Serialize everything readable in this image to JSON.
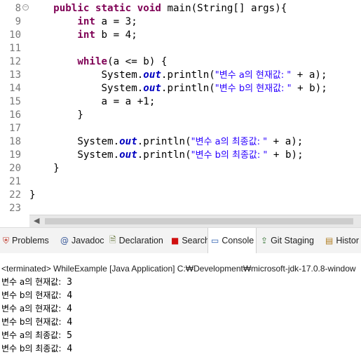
{
  "editor": {
    "lines": [
      {
        "n": "8",
        "seg": [
          {
            "t": "    "
          },
          {
            "t": "public static void",
            "c": "kw"
          },
          {
            "t": " main(String[] args){"
          }
        ]
      },
      {
        "n": "9",
        "seg": [
          {
            "t": "        "
          },
          {
            "t": "int",
            "c": "kw"
          },
          {
            "t": " a = 3;"
          }
        ]
      },
      {
        "n": "10",
        "seg": [
          {
            "t": "        "
          },
          {
            "t": "int",
            "c": "kw"
          },
          {
            "t": " b = 4;"
          }
        ]
      },
      {
        "n": "11",
        "seg": []
      },
      {
        "n": "12",
        "seg": [
          {
            "t": "        "
          },
          {
            "t": "while",
            "c": "kw"
          },
          {
            "t": "(a <= b) {"
          }
        ]
      },
      {
        "n": "13",
        "seg": [
          {
            "t": "            System."
          },
          {
            "t": "out",
            "c": "fld"
          },
          {
            "t": ".println("
          },
          {
            "t": "\"변수 a의 현재값: \"",
            "c": "str"
          },
          {
            "t": " + a);"
          }
        ]
      },
      {
        "n": "14",
        "seg": [
          {
            "t": "            System."
          },
          {
            "t": "out",
            "c": "fld"
          },
          {
            "t": ".println("
          },
          {
            "t": "\"변수 b의 현재값: \"",
            "c": "str"
          },
          {
            "t": " + b);"
          }
        ]
      },
      {
        "n": "15",
        "seg": [
          {
            "t": "            a = a +1;"
          }
        ]
      },
      {
        "n": "16",
        "seg": [
          {
            "t": "        }"
          }
        ]
      },
      {
        "n": "17",
        "seg": []
      },
      {
        "n": "18",
        "seg": [
          {
            "t": "        System."
          },
          {
            "t": "out",
            "c": "fld"
          },
          {
            "t": ".println("
          },
          {
            "t": "\"변수 a의 최종값: \"",
            "c": "str"
          },
          {
            "t": " + a);"
          }
        ]
      },
      {
        "n": "19",
        "seg": [
          {
            "t": "        System."
          },
          {
            "t": "out",
            "c": "fld"
          },
          {
            "t": ".println("
          },
          {
            "t": "\"변수 b의 최종값: \"",
            "c": "str"
          },
          {
            "t": " + b);"
          }
        ]
      },
      {
        "n": "20",
        "seg": [
          {
            "t": "    }"
          }
        ]
      },
      {
        "n": "21",
        "seg": []
      },
      {
        "n": "22",
        "seg": [
          {
            "t": "}"
          }
        ]
      },
      {
        "n": "23",
        "seg": []
      }
    ],
    "fold_icon": "minus-icon",
    "colors": {
      "keyword": "#7f0055",
      "field": "#0000c0",
      "string": "#2a00ff",
      "line_number": "#787878"
    }
  },
  "tabs": [
    {
      "label": "Problems",
      "icon": "problems-icon"
    },
    {
      "label": "Javadoc",
      "icon": "at-sign-icon"
    },
    {
      "label": "Declaration",
      "icon": "declaration-icon"
    },
    {
      "label": "Search",
      "icon": "search-square-icon"
    },
    {
      "label": "Console",
      "icon": "console-icon",
      "active": true
    },
    {
      "label": "Git Staging",
      "icon": "git-staging-icon"
    },
    {
      "label": "Histor",
      "icon": "history-icon"
    }
  ],
  "console": {
    "header": "<terminated> WhileExample [Java Application] C:₩Development₩microsoft-jdk-17.0.8-window",
    "output": [
      {
        "ko": "변수 a의 현재값:",
        "v": "3"
      },
      {
        "ko": "변수 b의 현재값:",
        "v": "4"
      },
      {
        "ko": "변수 a의 현재값:",
        "v": "4"
      },
      {
        "ko": "변수 b의 현재값:",
        "v": "4"
      },
      {
        "ko": "변수 a의 최종값:",
        "v": "5"
      },
      {
        "ko": "변수 b의 최종값:",
        "v": "4"
      }
    ]
  }
}
